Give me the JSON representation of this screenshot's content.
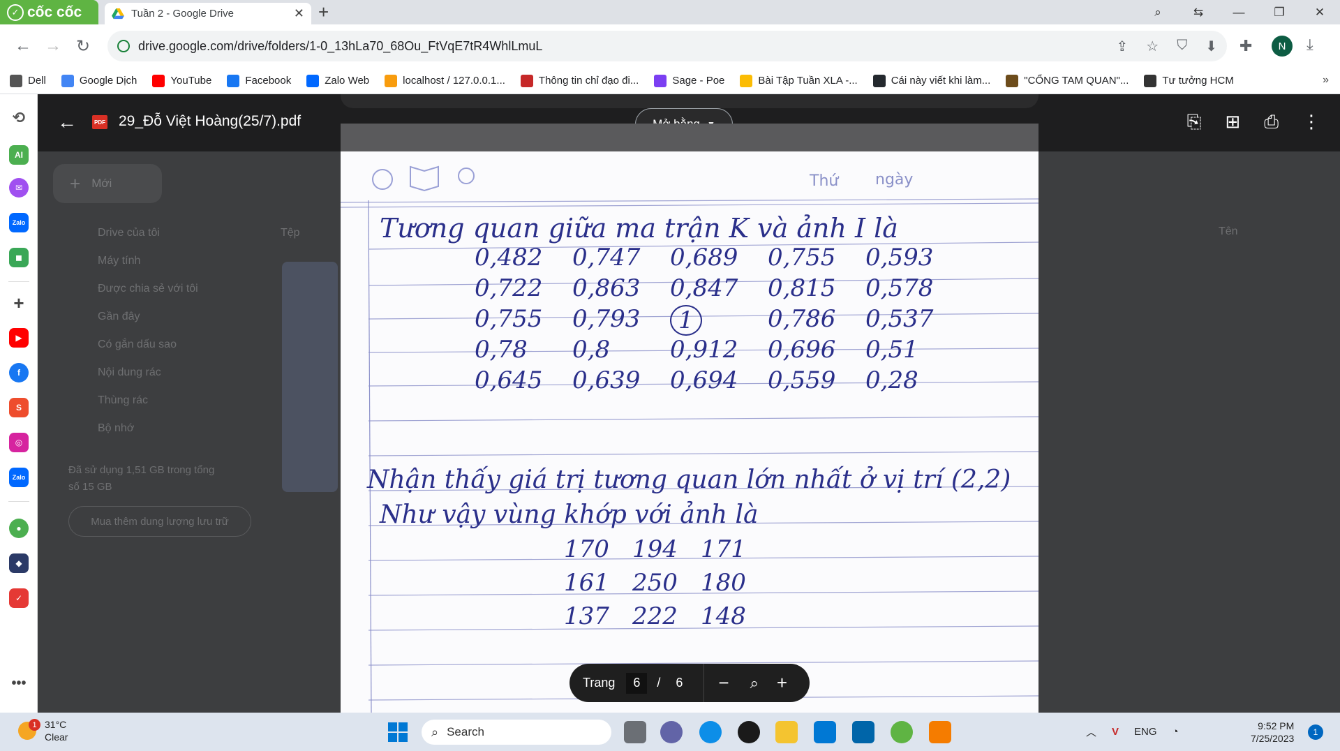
{
  "browser": {
    "brand": "cốc cốc",
    "tab_title": "Tuần 2 - Google Drive",
    "url": "drive.google.com/drive/folders/1-0_13hLa70_68Ou_FtVqE7tR4WhlLmuL",
    "profile_initial": "N"
  },
  "bookmarks": [
    {
      "label": "Dell",
      "color": "#555555"
    },
    {
      "label": "Google Dịch",
      "color": "#4285f4"
    },
    {
      "label": "YouTube",
      "color": "#ff0000"
    },
    {
      "label": "Facebook",
      "color": "#1877f2"
    },
    {
      "label": "Zalo Web",
      "color": "#0068ff"
    },
    {
      "label": "localhost / 127.0.0.1...",
      "color": "#f89c0e"
    },
    {
      "label": "Thông tin chỉ đạo đi...",
      "color": "#c62828"
    },
    {
      "label": "Sage - Poe",
      "color": "#7b3ff2"
    },
    {
      "label": "Bài Tập Tuần XLA -...",
      "color": "#fbbc04"
    },
    {
      "label": "Cái này viết khi làm...",
      "color": "#24292e"
    },
    {
      "label": "\"CỔNG TAM QUAN\"...",
      "color": "#6d4c1b"
    },
    {
      "label": "Tư tưởng HCM",
      "color": "#333333"
    }
  ],
  "drive_background": {
    "new_button": "Mới",
    "nav": [
      "Drive của tôi",
      "Máy tính",
      "Được chia sẻ với tôi",
      "Gần đây",
      "Có gắn dấu sao",
      "Nội dung rác",
      "Thùng rác",
      "Bộ nhớ"
    ],
    "storage_text": "Đã sử dụng 1,51 GB trong tổng số 15 GB",
    "buy_storage": "Mua thêm dung lượng lưu trữ",
    "files_header": "Tệp",
    "sort_label": "Tên"
  },
  "viewer": {
    "file_name": "29_Đỗ Việt Hoàng(25/7).pdf",
    "pdf_badge": "PDF",
    "open_with": "Mở bằng"
  },
  "document": {
    "header_weekday": "Thứ",
    "header_day": "ngày",
    "line1": "Tương quan giữa ma trận K và ảnh I là",
    "matrix": [
      [
        "0,482",
        "0,747",
        "0,689",
        "0,755",
        "0,593"
      ],
      [
        "0,722",
        "0,863",
        "0,847",
        "0,815",
        "0,578"
      ],
      [
        "0,755",
        "0,793",
        "1",
        "0,786",
        "0,537"
      ],
      [
        "0,78",
        "0,8",
        "0,912",
        "0,696",
        "0,51"
      ],
      [
        "0,645",
        "0,639",
        "0,694",
        "0,559",
        "0,28"
      ]
    ],
    "line2": "Nhận thấy giá trị tương quan lớn nhất ở vị trí (2,2)",
    "line3": "Như vậy vùng khớp với ảnh là",
    "block": [
      [
        "170",
        "194",
        "171"
      ],
      [
        "161",
        "250",
        "180"
      ],
      [
        "137",
        "222",
        "148"
      ]
    ]
  },
  "pager": {
    "label": "Trang",
    "current": "6",
    "separator": "/",
    "total": "6"
  },
  "taskbar": {
    "weather_badge": "1",
    "temperature": "31°C",
    "condition": "Clear",
    "search": "Search",
    "lang": "ENG",
    "time": "9:52 PM",
    "date": "7/25/2023",
    "notification_count": "1"
  }
}
